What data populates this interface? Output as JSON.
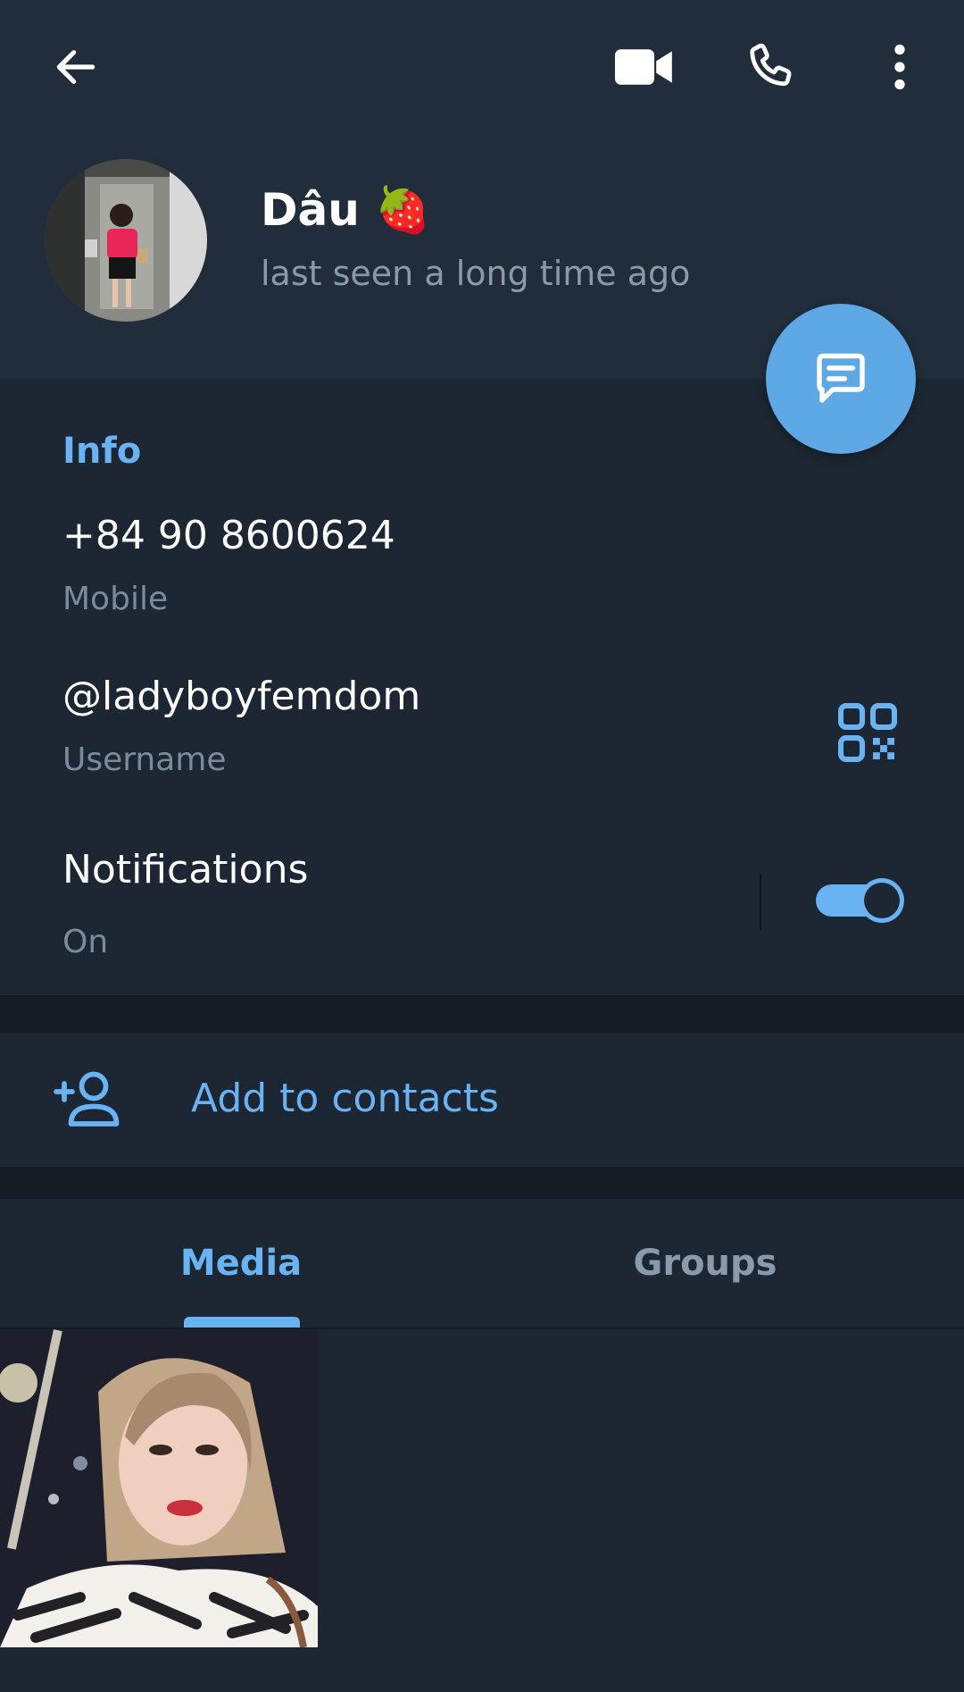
{
  "topbar": {
    "back_icon": "arrow-left-icon",
    "video_icon": "video-camera-icon",
    "call_icon": "phone-icon",
    "more_icon": "more-vertical-icon"
  },
  "profile": {
    "name": "Dâu 🍓",
    "status": "last seen a long time ago"
  },
  "info": {
    "title": "Info",
    "phone": "+84 90 8600624",
    "phone_label": "Mobile",
    "username": "@ladyboyfemdom",
    "username_label": "Username",
    "notifications": "Notifications",
    "notifications_state": "On",
    "notifications_enabled": true
  },
  "actions": {
    "add_contact": "Add to contacts"
  },
  "tabs": [
    {
      "label": "Media",
      "active": true
    },
    {
      "label": "Groups",
      "active": false
    }
  ],
  "colors": {
    "accent": "#6ab3f3",
    "fab": "#5da8e5",
    "background": "#1d2733",
    "header": "#212d3b"
  }
}
